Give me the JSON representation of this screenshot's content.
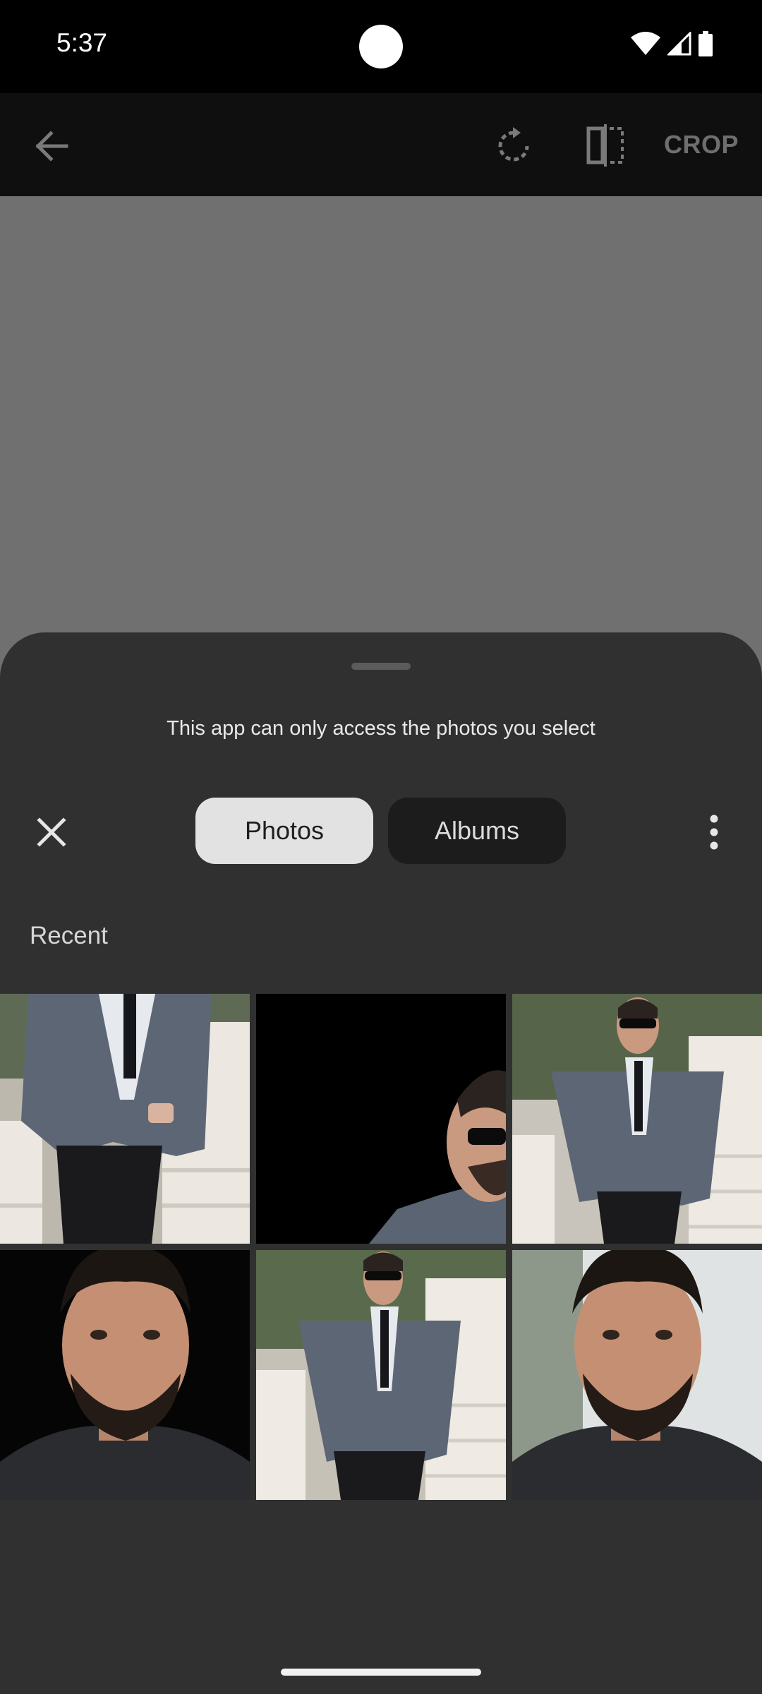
{
  "status_bar": {
    "time": "5:37",
    "icons": [
      "wifi-icon",
      "cell-signal-icon",
      "battery-icon"
    ]
  },
  "toolbar": {
    "back_icon": "arrow-back-icon",
    "rotate_icon": "rotate-icon",
    "flip_icon": "flip-icon",
    "crop_label": "CROP"
  },
  "sheet": {
    "info_text": "This app can only access the photos you select",
    "tabs": [
      {
        "label": "Photos",
        "selected": true
      },
      {
        "label": "Albums",
        "selected": false
      }
    ],
    "section_label": "Recent",
    "photos": [
      {
        "subject": "suit-torso"
      },
      {
        "subject": "sunglasses-closeup"
      },
      {
        "subject": "suit-full"
      },
      {
        "subject": "portrait-dark"
      },
      {
        "subject": "suit-stairs"
      },
      {
        "subject": "portrait-light"
      }
    ]
  },
  "colors": {
    "sheet_bg": "#303030",
    "preview_bg": "#707070",
    "toolbar_bg": "#0f0f0f",
    "tab_selected_bg": "#e2e2e2",
    "tab_unselected_bg": "#1c1c1c"
  }
}
